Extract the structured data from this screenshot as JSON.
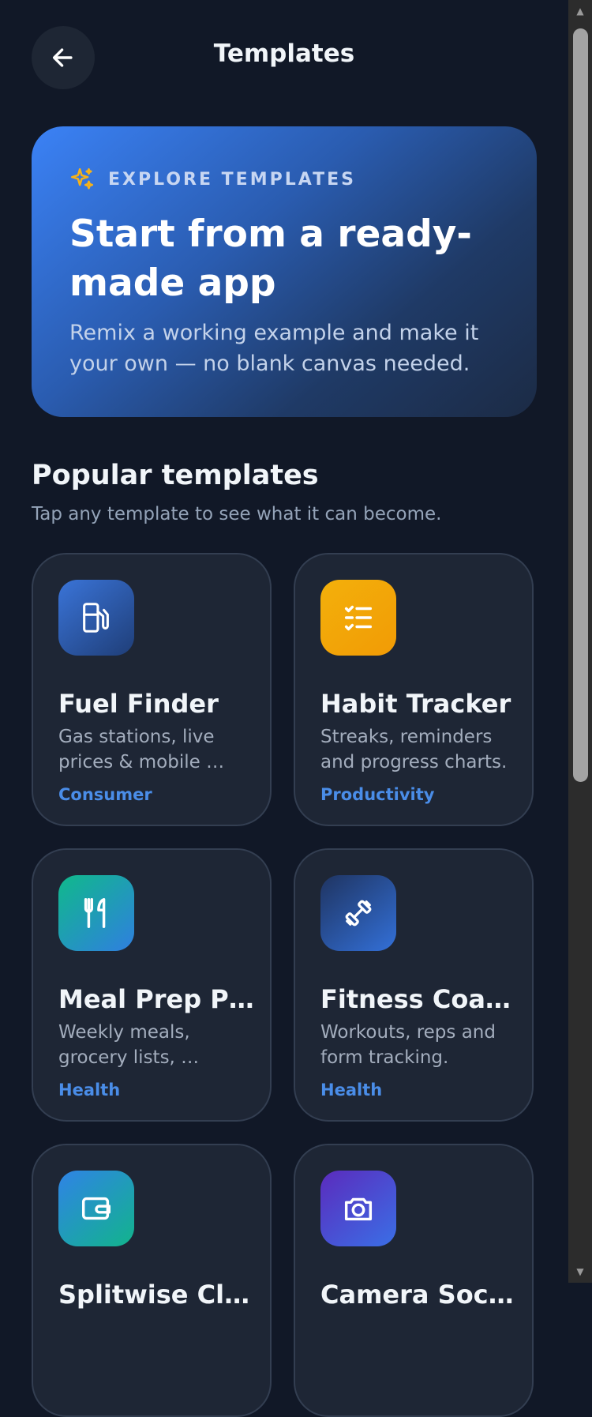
{
  "header": {
    "title": "Templates",
    "back_icon": "arrow-left-icon"
  },
  "hero": {
    "kicker": "EXPLORE TEMPLATES",
    "kicker_icon": "sparkles-icon",
    "title": "Start from a ready-made app",
    "subtitle": "Remix a working example and make it your own — no blank canvas needed."
  },
  "section": {
    "title": "Popular templates",
    "subtitle": "Tap any template to see what it can become."
  },
  "templates": [
    {
      "name": "Fuel Finder",
      "description": "Gas stations, live prices & mobile …",
      "category": "Consumer",
      "icon": "fuel-pump-icon"
    },
    {
      "name": "Habit Tracker",
      "description": "Streaks, reminders and progress charts.",
      "category": "Productivity",
      "icon": "checklist-icon"
    },
    {
      "name": "Meal Prep Pl…",
      "description": "Weekly meals, grocery lists, …",
      "category": "Health",
      "icon": "utensils-icon"
    },
    {
      "name": "Fitness Coach",
      "description": "Workouts, reps and form tracking.",
      "category": "Health",
      "icon": "dumbbell-icon"
    },
    {
      "name": "Splitwise Clo…",
      "description": "",
      "category": "",
      "icon": "wallet-icon"
    },
    {
      "name": "Camera Social",
      "description": "",
      "category": "",
      "icon": "camera-icon"
    }
  ],
  "colors": {
    "background": "#111827",
    "card": "#1e2635",
    "accent": "#4a8de8",
    "hero_gradient_start": "#3b82f6",
    "hero_gradient_end": "#1c2b45"
  }
}
